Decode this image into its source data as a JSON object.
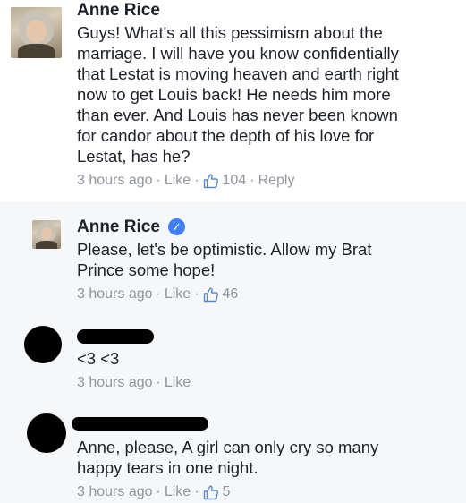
{
  "comments": [
    {
      "author": "Anne Rice",
      "text_lines": [
        "Guys! What's all this pessimism about the",
        "marriage.  I will have you know confidentially",
        "that Lestat is moving heaven and earth right",
        "now to get Louis back!  He needs him more",
        "than ever.  And Louis has never been known",
        "for candor about the depth of his love for",
        "Lestat, has he?"
      ],
      "time": "3 hours ago",
      "like_label": "Like",
      "likes": "104",
      "reply_label": "Reply"
    }
  ],
  "replies": [
    {
      "author": "Anne Rice",
      "verified": true,
      "text_lines": [
        "Please, let's be optimistic.  Allow my Brat",
        "Prince some hope!"
      ],
      "time": "3 hours ago",
      "like_label": "Like",
      "likes": "46"
    },
    {
      "author_redacted": true,
      "text_lines": [
        "<3 <3"
      ],
      "time": "3 hours ago",
      "like_label": "Like"
    },
    {
      "author_redacted": true,
      "text_lines": [
        "Anne, please, A girl can only cry so many",
        "happy tears in one night."
      ],
      "time": "3 hours ago",
      "like_label": "Like",
      "likes": "5"
    }
  ],
  "separator": "·",
  "colors": {
    "text": "#1d2129",
    "meta": "#90949c",
    "reply_background": "#f6f7f9",
    "verified_badge": "#4080ff"
  },
  "icons": {
    "like": "thumbs-up-outline-icon",
    "verified": "verified-badge-check-icon",
    "verified_glyph": "✓"
  }
}
